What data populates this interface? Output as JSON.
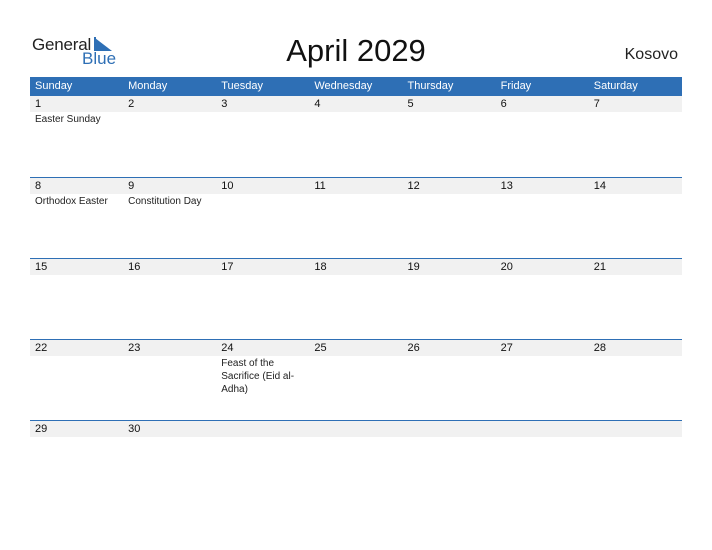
{
  "logo": {
    "general": "General",
    "blue": "Blue",
    "icon": "triangle-flag-icon"
  },
  "header": {
    "title": "April 2029",
    "country": "Kosovo"
  },
  "colors": {
    "accent": "#2e6fb5",
    "band": "#f1f1f1"
  },
  "weekdays": [
    "Sunday",
    "Monday",
    "Tuesday",
    "Wednesday",
    "Thursday",
    "Friday",
    "Saturday"
  ],
  "weeks": [
    [
      {
        "day": "1",
        "event": "Easter Sunday"
      },
      {
        "day": "2",
        "event": ""
      },
      {
        "day": "3",
        "event": ""
      },
      {
        "day": "4",
        "event": ""
      },
      {
        "day": "5",
        "event": ""
      },
      {
        "day": "6",
        "event": ""
      },
      {
        "day": "7",
        "event": ""
      }
    ],
    [
      {
        "day": "8",
        "event": "Orthodox Easter"
      },
      {
        "day": "9",
        "event": "Constitution Day"
      },
      {
        "day": "10",
        "event": ""
      },
      {
        "day": "11",
        "event": ""
      },
      {
        "day": "12",
        "event": ""
      },
      {
        "day": "13",
        "event": ""
      },
      {
        "day": "14",
        "event": ""
      }
    ],
    [
      {
        "day": "15",
        "event": ""
      },
      {
        "day": "16",
        "event": ""
      },
      {
        "day": "17",
        "event": ""
      },
      {
        "day": "18",
        "event": ""
      },
      {
        "day": "19",
        "event": ""
      },
      {
        "day": "20",
        "event": ""
      },
      {
        "day": "21",
        "event": ""
      }
    ],
    [
      {
        "day": "22",
        "event": ""
      },
      {
        "day": "23",
        "event": ""
      },
      {
        "day": "24",
        "event": "Feast of the Sacrifice (Eid al-Adha)"
      },
      {
        "day": "25",
        "event": ""
      },
      {
        "day": "26",
        "event": ""
      },
      {
        "day": "27",
        "event": ""
      },
      {
        "day": "28",
        "event": ""
      }
    ],
    [
      {
        "day": "29",
        "event": ""
      },
      {
        "day": "30",
        "event": ""
      },
      {
        "day": "",
        "event": ""
      },
      {
        "day": "",
        "event": ""
      },
      {
        "day": "",
        "event": ""
      },
      {
        "day": "",
        "event": ""
      },
      {
        "day": "",
        "event": ""
      }
    ]
  ]
}
